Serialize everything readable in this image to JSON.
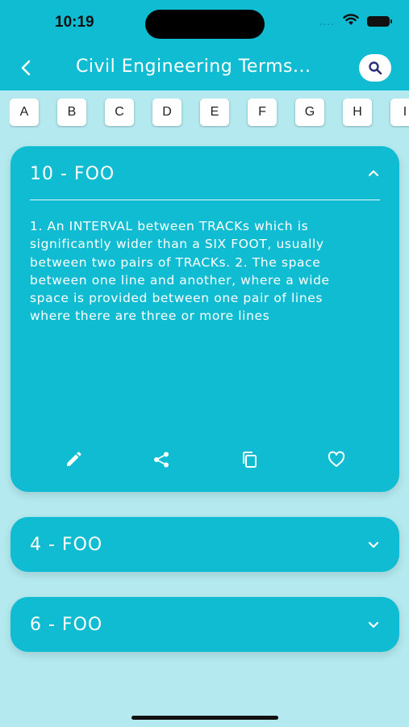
{
  "status_bar": {
    "time": "10:19",
    "signal_dots": "....",
    "icons": [
      "wifi-icon",
      "battery-icon"
    ]
  },
  "app_bar": {
    "title": "Civil Engineering Terms...",
    "back_icon": "chevron-left-icon",
    "search_icon": "search-icon"
  },
  "alphabet": [
    "A",
    "B",
    "C",
    "D",
    "E",
    "F",
    "G",
    "H",
    "I"
  ],
  "terms": [
    {
      "title": "10 - FOO",
      "expanded": true,
      "definition": "1. An INTERVAL between TRACKs which is significantly wider than a SIX FOOT, usually between two pairs of TRACKs. 2. The space between one line and another, where a wide space is provided between one pair of lines where there are three or more lines",
      "actions": [
        "edit-icon",
        "share-icon",
        "copy-icon",
        "favorite-icon"
      ]
    },
    {
      "title": "4 - FOO",
      "expanded": false
    },
    {
      "title": "6 - FOO",
      "expanded": false
    }
  ],
  "colors": {
    "accent": "#0fbcd2",
    "background": "#b3e9ef",
    "search_icon": "#2b2f7a"
  }
}
